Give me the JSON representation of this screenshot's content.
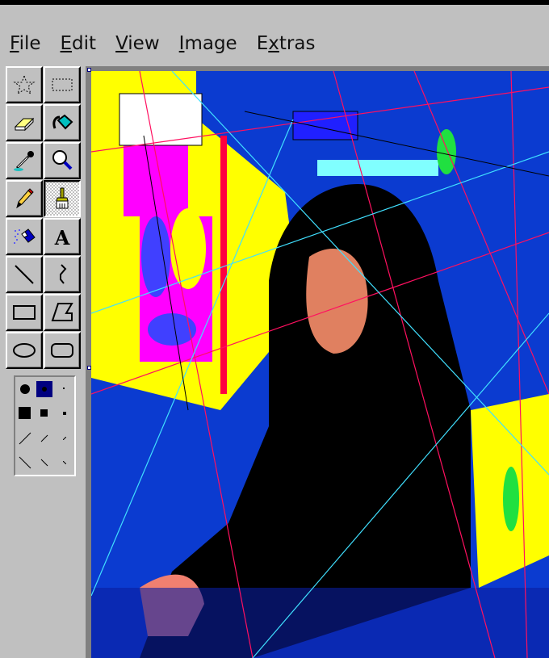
{
  "menu": [
    {
      "label": "File",
      "accel": "F",
      "rest": "ile"
    },
    {
      "label": "Edit",
      "accel": "E",
      "rest": "dit"
    },
    {
      "label": "View",
      "accel": "V",
      "rest": "iew"
    },
    {
      "label": "Image",
      "accel": "I",
      "rest": "mage"
    },
    {
      "label": "Extras",
      "pre": "E",
      "accel": "x",
      "rest": "tras"
    }
  ],
  "toolbox": {
    "selected_tool": "brush"
  },
  "colors": {
    "canvas_bg": "#0b3bd0",
    "yellow": "#ffff00",
    "magenta": "#ff00ff",
    "black": "#000000",
    "cyan": "#00ffff",
    "red": "#ff0040"
  }
}
